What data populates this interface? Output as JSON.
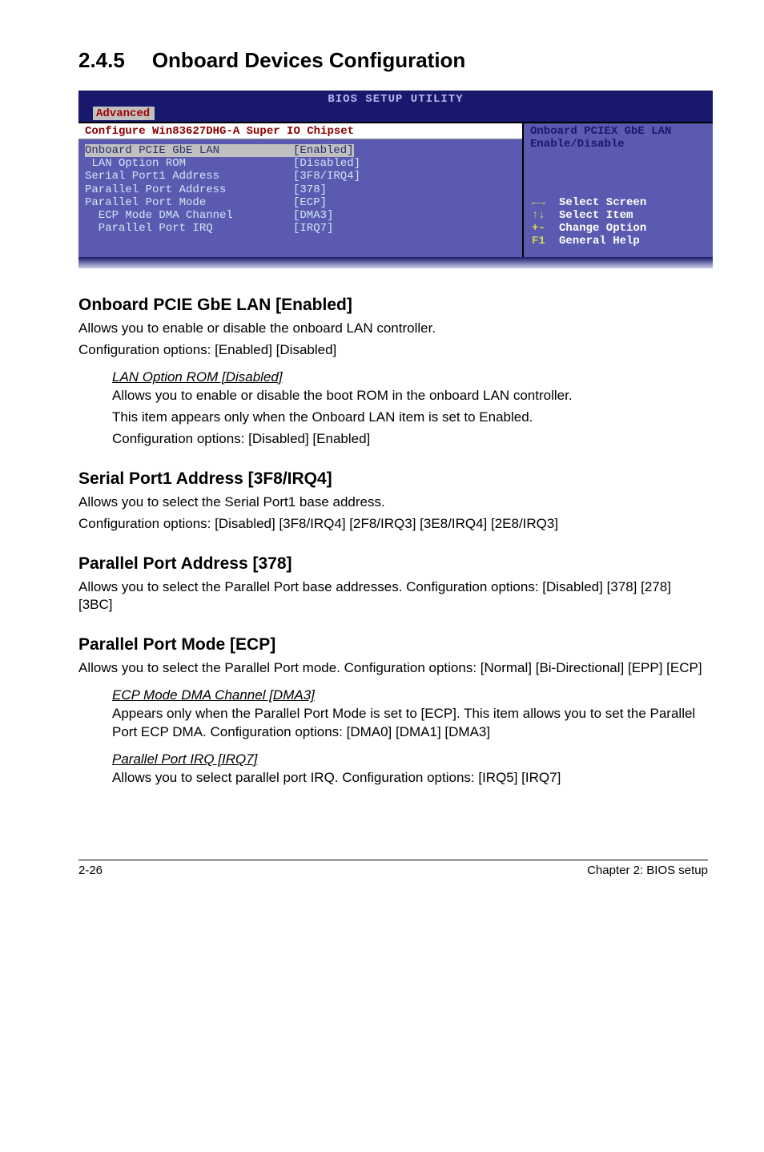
{
  "section": {
    "number": "2.4.5",
    "title": "Onboard Devices Configuration"
  },
  "bios": {
    "window_title": "BIOS SETUP UTILITY",
    "active_tab": "Advanced",
    "header": "Configure Win83627DHG-A Super IO Chipset",
    "rows": [
      {
        "label": "Onboard PCIE GbE LAN",
        "value": "[Enabled]",
        "highlight": true
      },
      {
        "label": " LAN Option ROM",
        "value": "[Disabled]"
      },
      {
        "label": "",
        "value": ""
      },
      {
        "label": "Serial Port1 Address",
        "value": "[3F8/IRQ4]"
      },
      {
        "label": "Parallel Port Address",
        "value": "[378]"
      },
      {
        "label": "Parallel Port Mode",
        "value": "[ECP]"
      },
      {
        "label": "  ECP Mode DMA Channel",
        "value": "[DMA3]"
      },
      {
        "label": "  Parallel Port IRQ",
        "value": "[IRQ7]"
      }
    ],
    "help": [
      "Onboard PCIEX GbE LAN",
      "Enable/Disable"
    ],
    "nav": [
      {
        "sym": "←→",
        "text": "Select Screen"
      },
      {
        "sym": "↑↓",
        "text": "Select Item"
      },
      {
        "sym": "+-",
        "text": "Change Option"
      },
      {
        "sym": "F1",
        "text": "General Help"
      }
    ]
  },
  "h_pcie": "Onboard PCIE GbE LAN [Enabled]",
  "p_pcie_1": "Allows you to enable or disable the onboard LAN controller.",
  "p_pcie_2": "Configuration options: [Enabled] [Disabled]",
  "lan_opt_rom_title": "LAN Option ROM [Disabled]",
  "lan_opt_rom_1": "Allows you to enable or disable the boot ROM in the onboard LAN controller.",
  "lan_opt_rom_2": "This item appears only when the Onboard LAN item is set to Enabled.",
  "lan_opt_rom_3": "Configuration options: [Disabled] [Enabled]",
  "h_serial": "Serial Port1 Address [3F8/IRQ4]",
  "p_serial_1": "Allows you to select the Serial Port1 base address.",
  "p_serial_2": "Configuration options: [Disabled] [3F8/IRQ4] [2F8/IRQ3] [3E8/IRQ4] [2E8/IRQ3]",
  "h_paddr": "Parallel Port Address [378]",
  "p_paddr_1": "Allows you to select the Parallel Port base addresses. Configuration options: [Disabled] [378] [278] [3BC]",
  "h_pmode": "Parallel Port Mode [ECP]",
  "p_pmode_1": "Allows you to select the Parallel Port  mode. Configuration options: [Normal] [Bi-Directional] [EPP] [ECP]",
  "ecp_title": "ECP Mode DMA Channel [DMA3]",
  "ecp_body": "Appears only when the Parallel Port Mode is set to [ECP]. This item allows you to set the Parallel Port ECP DMA. Configuration options: [DMA0] [DMA1] [DMA3]",
  "ppirq_title": "Parallel Port IRQ [IRQ7]",
  "ppirq_body": "Allows you to select parallel port IRQ. Configuration options: [IRQ5] [IRQ7]",
  "footer_left": "2-26",
  "footer_right": "Chapter 2: BIOS setup"
}
